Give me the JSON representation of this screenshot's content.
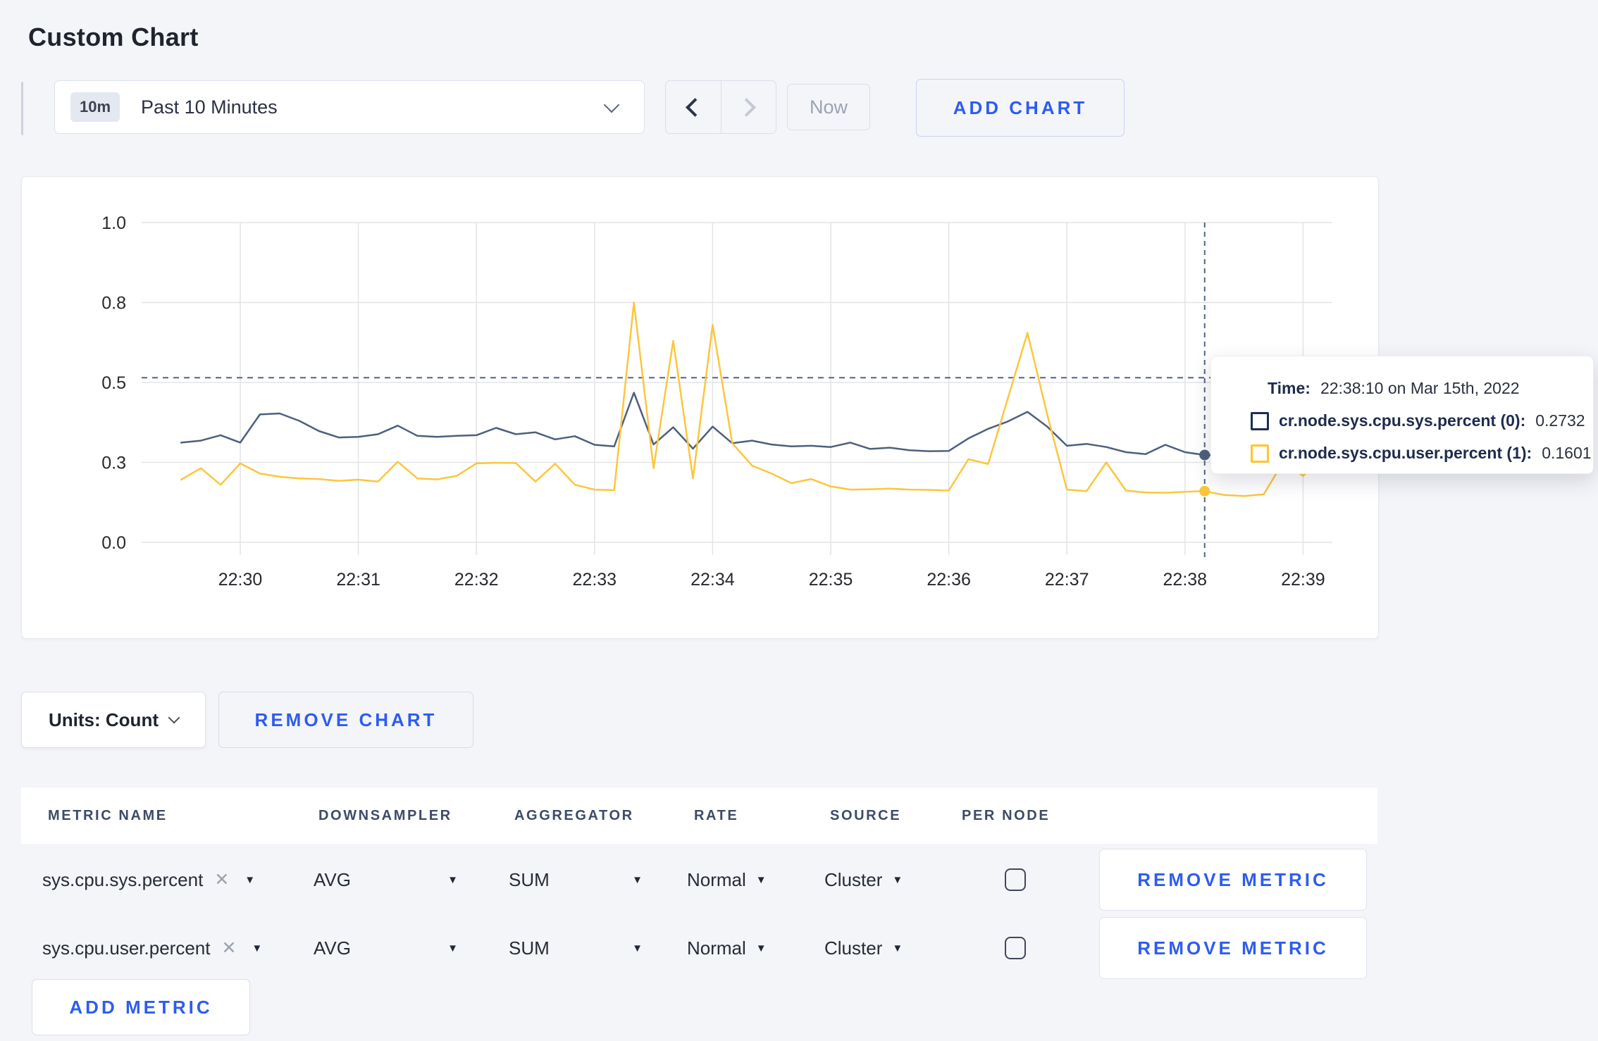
{
  "page": {
    "title": "Custom Chart"
  },
  "toolbar": {
    "range_badge": "10m",
    "range_label": "Past 10 Minutes",
    "now_label": "Now",
    "add_chart_label": "ADD CHART"
  },
  "icons": {
    "clear_x": "✕",
    "dropdown_arrow": "▼"
  },
  "tooltip": {
    "time_label": "Time:",
    "time_value": "22:38:10 on Mar 15th, 2022",
    "rows": [
      {
        "label": "cr.node.sys.cpu.sys.percent (0):",
        "value": "0.2732"
      },
      {
        "label": "cr.node.sys.cpu.user.percent (1):",
        "value": "0.1601"
      }
    ]
  },
  "units_row": {
    "units_label": "Units: Count",
    "remove_chart_label": "REMOVE CHART"
  },
  "metrics_table": {
    "columns": [
      "METRIC NAME",
      "DOWNSAMPLER",
      "AGGREGATOR",
      "RATE",
      "SOURCE",
      "PER NODE"
    ],
    "rows": [
      {
        "name": "sys.cpu.sys.percent",
        "downsampler": "AVG",
        "aggregator": "SUM",
        "rate": "Normal",
        "source": "Cluster",
        "per_node_checked": false,
        "remove_label": "REMOVE METRIC"
      },
      {
        "name": "sys.cpu.user.percent",
        "downsampler": "AVG",
        "aggregator": "SUM",
        "rate": "Normal",
        "source": "Cluster",
        "per_node_checked": false,
        "remove_label": "REMOVE METRIC"
      }
    ],
    "add_metric_label": "ADD METRIC"
  },
  "chart_data": {
    "type": "line",
    "title": "",
    "xlabel": "",
    "ylabel": "",
    "ylim": [
      0,
      1
    ],
    "grid": true,
    "legend_position": "none",
    "x_ticks": [
      "22:30",
      "22:31",
      "22:32",
      "22:33",
      "22:34",
      "22:35",
      "22:36",
      "22:37",
      "22:38",
      "22:39"
    ],
    "y_ticks": {
      "values": [
        0,
        0.25,
        0.5,
        0.75,
        1.0
      ],
      "labels": [
        "0.0",
        "0.3",
        "0.5",
        "0.8",
        "1.0"
      ]
    },
    "x_start_offset_minutes": -0.5,
    "x_step_seconds": 10,
    "threshold_value": 0.515,
    "crosshair": {
      "time": "22:38:10",
      "minutes_from_first_tick": 8.1667
    },
    "series": [
      {
        "name": "cr.node.sys.cpu.sys.percent (0)",
        "line_color": "#4e5f7e",
        "swatch_color": "#1e2d50",
        "value_at_crosshair": 0.2732,
        "values": [
          0.312,
          0.318,
          0.335,
          0.312,
          0.4,
          0.403,
          0.38,
          0.348,
          0.328,
          0.33,
          0.338,
          0.365,
          0.333,
          0.33,
          0.333,
          0.335,
          0.358,
          0.338,
          0.344,
          0.322,
          0.332,
          0.305,
          0.3,
          0.468,
          0.306,
          0.36,
          0.293,
          0.362,
          0.31,
          0.318,
          0.306,
          0.3,
          0.302,
          0.298,
          0.312,
          0.292,
          0.296,
          0.288,
          0.285,
          0.286,
          0.325,
          0.355,
          0.378,
          0.408,
          0.362,
          0.302,
          0.308,
          0.298,
          0.282,
          0.276,
          0.305,
          0.282,
          0.2732,
          0.272,
          0.298,
          0.315,
          0.296,
          0.29,
          0.306
        ]
      },
      {
        "name": "cr.node.sys.cpu.user.percent (1)",
        "line_color": "#fcc63d",
        "swatch_color": "#ffc726",
        "value_at_crosshair": 0.1601,
        "values": [
          0.196,
          0.232,
          0.18,
          0.247,
          0.215,
          0.205,
          0.2,
          0.198,
          0.192,
          0.196,
          0.19,
          0.252,
          0.2,
          0.197,
          0.208,
          0.247,
          0.249,
          0.248,
          0.19,
          0.246,
          0.18,
          0.165,
          0.163,
          0.75,
          0.232,
          0.63,
          0.2,
          0.68,
          0.31,
          0.24,
          0.215,
          0.185,
          0.198,
          0.175,
          0.165,
          0.166,
          0.168,
          0.165,
          0.164,
          0.162,
          0.26,
          0.245,
          0.45,
          0.655,
          0.4,
          0.165,
          0.16,
          0.25,
          0.162,
          0.156,
          0.155,
          0.158,
          0.1601,
          0.148,
          0.145,
          0.15,
          0.252,
          0.208,
          0.265
        ]
      }
    ]
  }
}
